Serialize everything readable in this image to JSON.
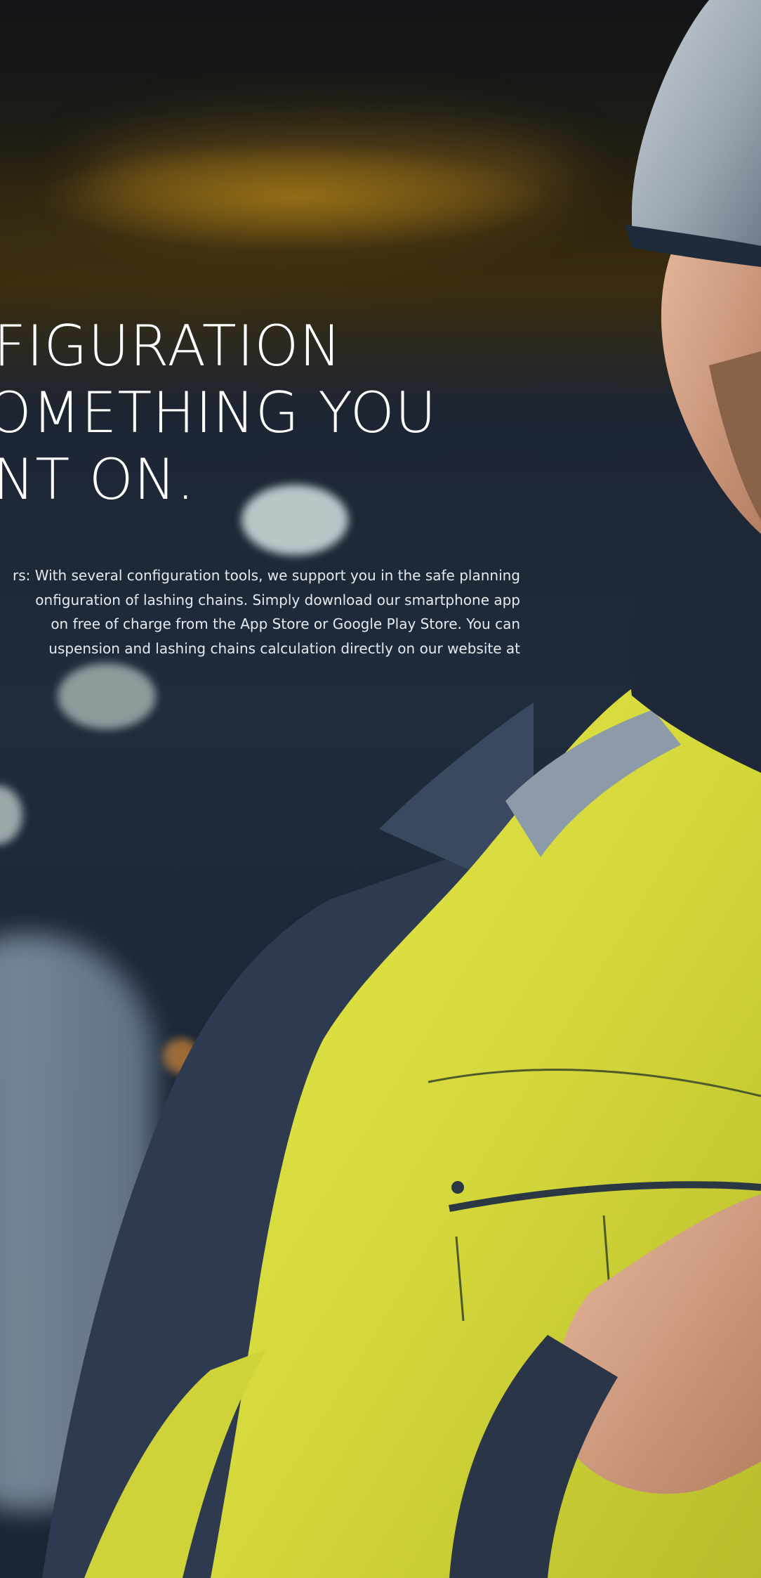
{
  "hero": {
    "headline": [
      "NFIGURATION",
      "SOMETHING YOU",
      "UNT ON."
    ],
    "body": [
      "rs: With several configuration tools, we support you in the safe planning",
      "onfiguration of lashing chains. Simply download our smartphone app",
      "on free of charge from the App Store or Google Play Store. You can",
      "uspension and lashing chains calculation directly on our website at"
    ],
    "colors": {
      "jacket_yellow": "#d8dc3a",
      "jacket_navy": "#2a3547",
      "helmet": "#aab3bd",
      "text": "#ffffff"
    }
  }
}
